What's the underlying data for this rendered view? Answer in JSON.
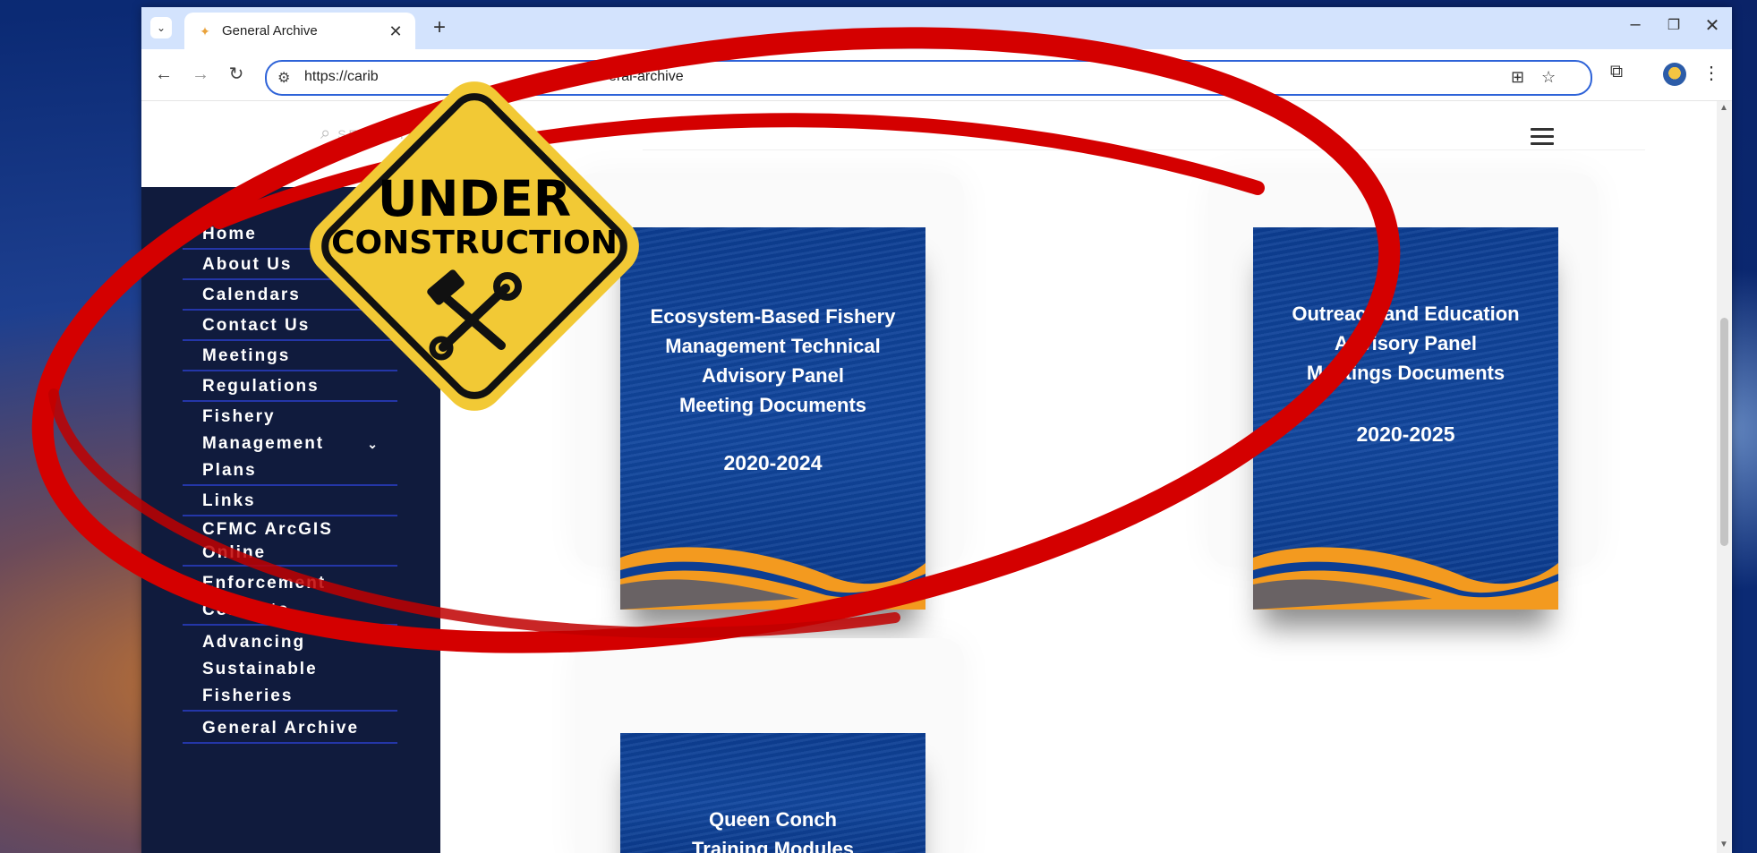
{
  "browser": {
    "tab_title": "General Archive",
    "new_tab_symbol": "+",
    "url_visible_start": "https://carib",
    "url_visible_end": "eral-archive"
  },
  "page": {
    "search_placeholder": "SEARCH"
  },
  "sidebar": {
    "items": [
      {
        "label": "Home"
      },
      {
        "label": "About Us"
      },
      {
        "label": "Calendars"
      },
      {
        "label": "Contact Us"
      },
      {
        "label": "Meetings"
      },
      {
        "label": "Regulations"
      },
      {
        "label": "Fishery Management Plans",
        "lines": [
          "Fishery",
          "Management",
          "Plans"
        ],
        "has_dropdown": true
      },
      {
        "label": "Links"
      },
      {
        "label": "CFMC ArcGIS Online",
        "lines": [
          "CFMC ArcGIS",
          "Online"
        ]
      },
      {
        "label": "Enforcement Contacts",
        "lines": [
          "Enforcement",
          "Contacts"
        ]
      },
      {
        "label": "Advancing Sustainable Fisheries",
        "lines": [
          "Advancing",
          "Sustainable",
          "Fisheries"
        ]
      },
      {
        "label": "General Archive"
      }
    ]
  },
  "cards": [
    {
      "lines": [
        "Ecosystem-Based Fishery",
        "Management Technical",
        "Advisory Panel",
        "Meeting Documents"
      ],
      "years": "2020-2024"
    },
    {
      "lines": [
        "Outreach and Education",
        "Advisory Panel",
        "Meetings Documents"
      ],
      "years": "2020-2025"
    },
    {
      "lines": [
        "Queen Conch",
        "Training Modules"
      ],
      "years": ""
    }
  ],
  "sign": {
    "line1": "UNDER",
    "line2": "CONSTRUCTION"
  },
  "colors": {
    "sidebar_bg": "#101b3d",
    "nav_underline": "#2436a8",
    "card_blue": "#0d3e93",
    "wave_orange": "#f39a1f",
    "sign_yellow": "#f2c935",
    "circle_red": "#d40000"
  },
  "icons": [
    "tab-search-icon",
    "favicon-icon",
    "close-tab-icon",
    "minimize-icon",
    "restore-icon",
    "close-window-icon",
    "back-icon",
    "forward-icon",
    "reload-icon",
    "site-info-icon",
    "translate-icon",
    "bookmark-star-icon",
    "extensions-icon",
    "menu-dots-icon",
    "search-icon",
    "hamburger-menu-icon",
    "chevron-down-icon",
    "hammer-wrench-icon"
  ]
}
